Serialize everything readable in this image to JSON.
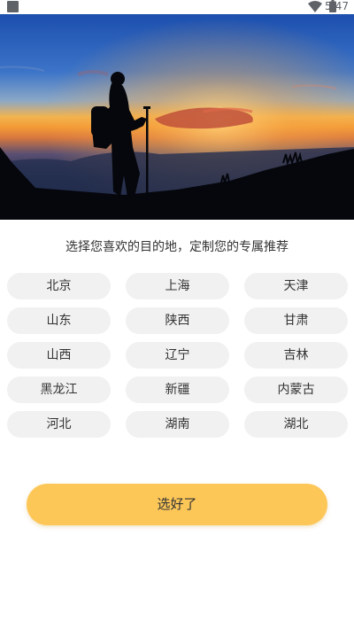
{
  "status_bar": {
    "time": "5:47",
    "icons": [
      "notification-square-icon",
      "wifi-icon",
      "battery-icon"
    ]
  },
  "hero": {
    "image": "hiker-silhouette-sunset-photo"
  },
  "subtitle": "选择您喜欢的目的地，定制您的专属推荐",
  "regions": [
    "北京",
    "上海",
    "天津",
    "山东",
    "陕西",
    "甘肃",
    "山西",
    "辽宁",
    "吉林",
    "黑龙江",
    "新疆",
    "内蒙古",
    "河北",
    "湖南",
    "湖北"
  ],
  "confirm_label": "选好了",
  "colors": {
    "chip_bg": "#f1f1f1",
    "button_accent": "#fdc758",
    "text": "#333333"
  }
}
